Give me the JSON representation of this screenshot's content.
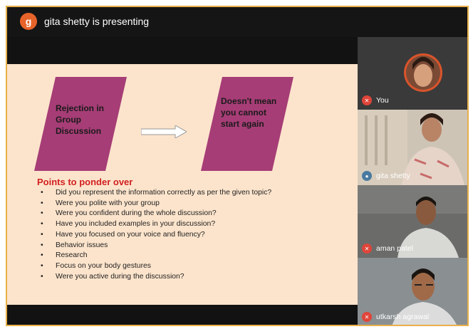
{
  "presenter": {
    "avatar_letter": "g",
    "status_text": "gita shetty is presenting"
  },
  "slide": {
    "shape1_text": "Rejection in Group Discussion",
    "shape2_text": "Doesn't mean you cannot start again",
    "points_title": "Points to ponder over",
    "points": [
      "Did you represent the information correctly as per the given topic?",
      "Were you polite with your group",
      "Were you confident during the whole discussion?",
      "Have you included examples in your discussion?",
      "Have you focused on your voice and fluency?",
      "Behavior issues",
      "Research",
      "Focus on your body gestures",
      "Were you active during the discussion?"
    ]
  },
  "participants": [
    {
      "name": "You",
      "mic": "mic-off-icon"
    },
    {
      "name": "gita shetty",
      "mic": "mic-icon"
    },
    {
      "name": "aman patel",
      "mic": "mic-off-icon"
    },
    {
      "name": "utkarsh agrawal",
      "mic": "mic-off-icon"
    }
  ],
  "colors": {
    "accent_border": "#e8b04a",
    "avatar_bg": "#e8632a",
    "slide_bg": "#fce4cc",
    "shape_fill": "#a63d76",
    "points_title": "#d22020",
    "mic_off": "#e0453a"
  }
}
